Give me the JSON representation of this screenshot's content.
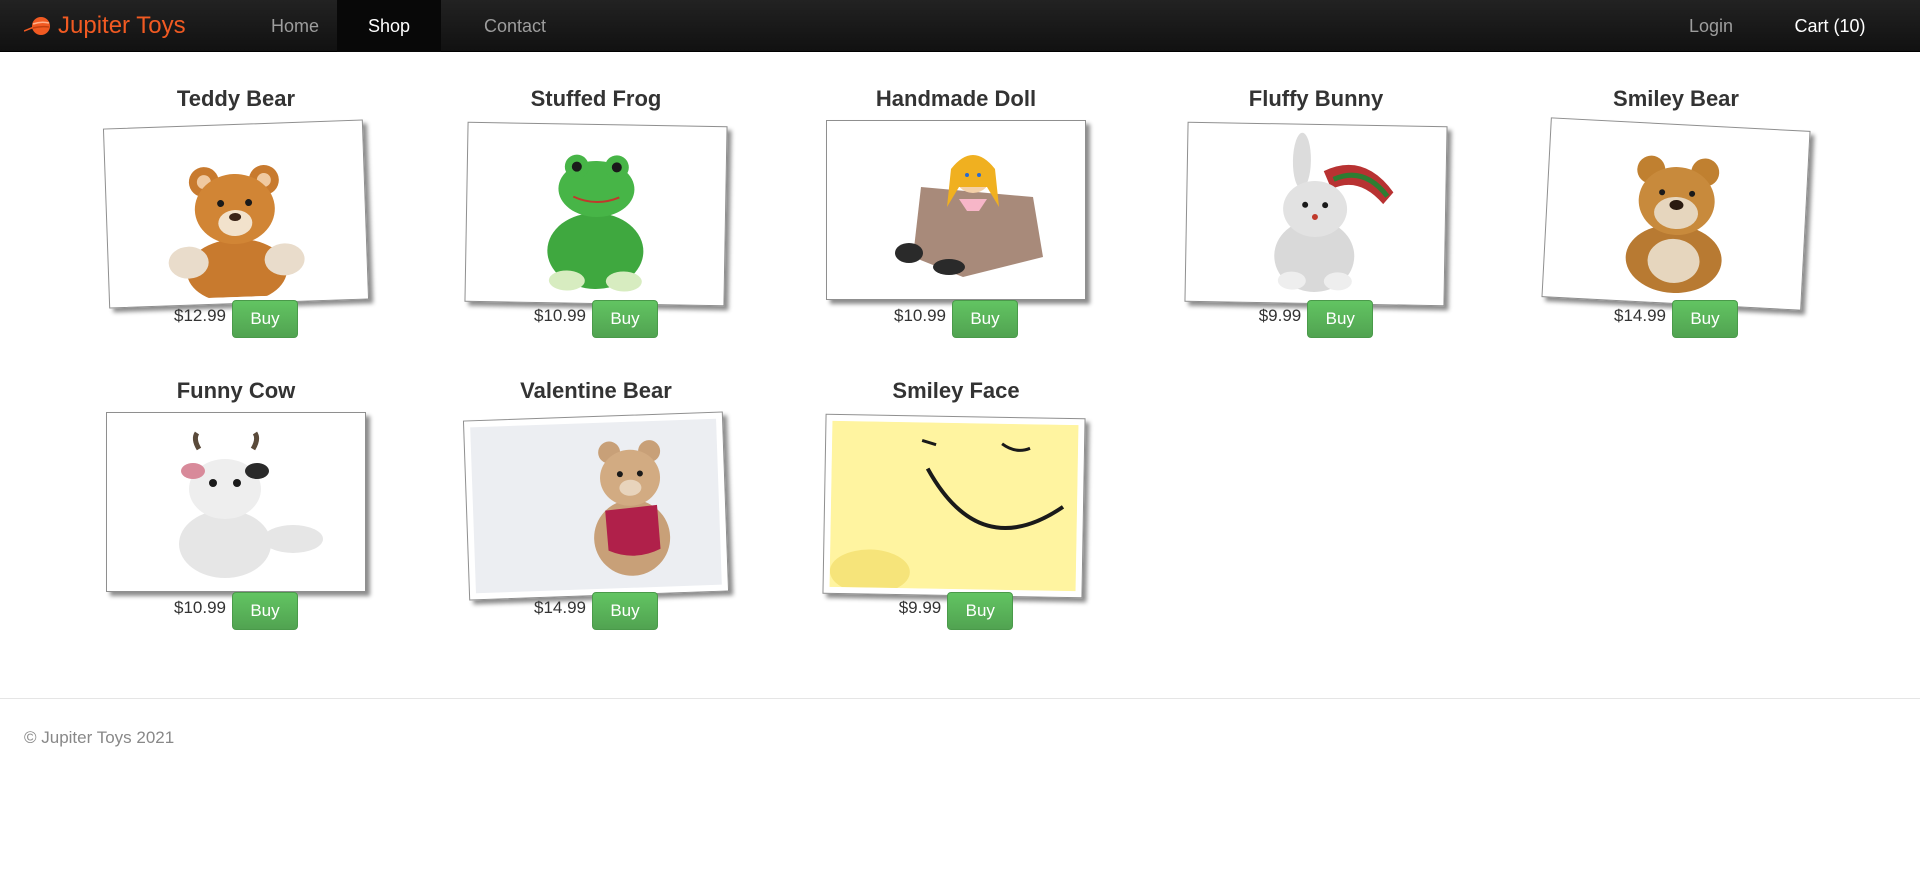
{
  "brand": {
    "name": "Jupiter Toys"
  },
  "nav": {
    "home": "Home",
    "shop": "Shop",
    "contact": "Contact",
    "login": "Login",
    "cart": "Cart (10)"
  },
  "products": [
    {
      "title": "Teddy Bear",
      "price": "$12.99",
      "buy": "Buy",
      "image": "teddy-bear"
    },
    {
      "title": "Stuffed Frog",
      "price": "$10.99",
      "buy": "Buy",
      "image": "stuffed-frog"
    },
    {
      "title": "Handmade Doll",
      "price": "$10.99",
      "buy": "Buy",
      "image": "handmade-doll"
    },
    {
      "title": "Fluffy Bunny",
      "price": "$9.99",
      "buy": "Buy",
      "image": "fluffy-bunny"
    },
    {
      "title": "Smiley Bear",
      "price": "$14.99",
      "buy": "Buy",
      "image": "smiley-bear"
    },
    {
      "title": "Funny Cow",
      "price": "$10.99",
      "buy": "Buy",
      "image": "funny-cow"
    },
    {
      "title": "Valentine Bear",
      "price": "$14.99",
      "buy": "Buy",
      "image": "valentine-bear"
    },
    {
      "title": "Smiley Face",
      "price": "$9.99",
      "buy": "Buy",
      "image": "smiley-face"
    }
  ],
  "footer": {
    "copyright": "© Jupiter Toys 2021"
  },
  "colors": {
    "brand": "#f15a22",
    "buy": "#5bb75b",
    "navbar": "#1b1b1b"
  }
}
